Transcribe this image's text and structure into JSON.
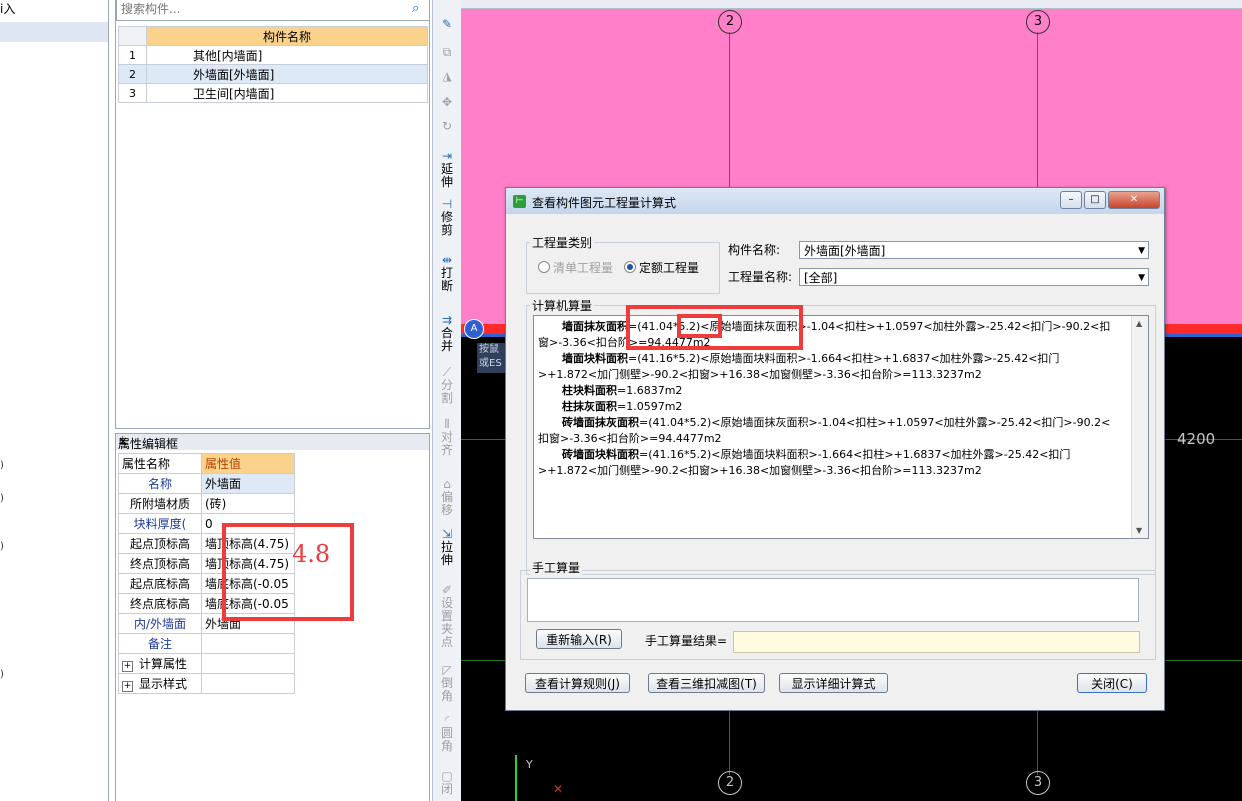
{
  "left_panel": {
    "partial_label": "i入"
  },
  "search": {
    "placeholder": "搜索构件..."
  },
  "component_table": {
    "header": "构件名称",
    "rows": [
      {
        "num": "1",
        "name": "其他[内墙面]"
      },
      {
        "num": "2",
        "name": "外墙面[外墙面]"
      },
      {
        "num": "3",
        "name": "卫生间[内墙面]"
      }
    ],
    "selected_index": 1
  },
  "property_panel": {
    "title": "属性编辑框",
    "pin": "📌",
    "close": "×",
    "col_name": "属性名称",
    "col_value": "属性值",
    "rows": [
      {
        "name": "名称",
        "value": "外墙面"
      },
      {
        "name": "所附墙材质",
        "value": "(砖)"
      },
      {
        "name": "块料厚度(",
        "value": "0"
      },
      {
        "name": "起点顶标高",
        "value": "墙顶标高(4.75)"
      },
      {
        "name": "终点顶标高",
        "value": "墙顶标高(4.75)"
      },
      {
        "name": "起点底标高",
        "value": "墙底标高(-0.05"
      },
      {
        "name": "终点底标高",
        "value": "墙底标高(-0.05"
      },
      {
        "name": "内/外墙面",
        "value": "外墙面"
      },
      {
        "name": "备注",
        "value": ""
      },
      {
        "name": "计算属性",
        "value": "",
        "expand": "+"
      },
      {
        "name": "显示样式",
        "value": "",
        "expand": "+"
      }
    ]
  },
  "vertical_toolbar": {
    "items": [
      {
        "icon": "pencil-icon",
        "label": ""
      },
      {
        "icon": "copy-icon",
        "label": ""
      },
      {
        "icon": "mirror-icon",
        "label": ""
      },
      {
        "icon": "move-icon",
        "label": ""
      },
      {
        "icon": "rotate-icon",
        "label": ""
      },
      {
        "icon": "extend-icon",
        "label": "延伸"
      },
      {
        "icon": "trim-icon",
        "label": "修剪"
      },
      {
        "icon": "break-icon",
        "label": "打断"
      },
      {
        "icon": "merge-icon",
        "label": "合并"
      },
      {
        "icon": "split-icon",
        "label": "分割"
      },
      {
        "icon": "align-icon",
        "label": "对齐"
      },
      {
        "icon": "offset-icon",
        "label": "偏移"
      },
      {
        "icon": "stretch-icon",
        "label": "拉伸"
      },
      {
        "icon": "set-point-icon",
        "label": "设置夹点"
      },
      {
        "icon": "chamfer-icon",
        "label": "倒角"
      },
      {
        "icon": "fillet-icon",
        "label": "圆角"
      },
      {
        "icon": "close-icon",
        "label": "闭"
      }
    ]
  },
  "canvas": {
    "axis_labels_top": [
      "2",
      "3"
    ],
    "axis_labels_bottom": [
      "2",
      "3"
    ],
    "left_axis_label": "A",
    "dimension": "4200",
    "hint_text": "按鼠或ES",
    "y_axis": "Y"
  },
  "dialog": {
    "title": "查看构件图元工程量计算式",
    "qty_type_group": "工程量类别",
    "radio_list": "清单工程量",
    "radio_quota": "定额工程量",
    "component_name_label": "构件名称:",
    "component_name_value": "外墙面[外墙面]",
    "qty_name_label": "工程量名称:",
    "qty_name_value": "[全部]",
    "computer_calc_label": "计算机算量",
    "calc_lines": [
      {
        "key": "墙面抹灰面积",
        "text": "=(41.04*5.2)<原始墙面抹灰面积>-1.04<扣柱>+1.0597<加柱外露>-25.42<扣门>-90.2<扣窗>-3.36<扣台阶>=94.4477m2"
      },
      {
        "key": "墙面块料面积",
        "text": "=(41.16*5.2)<原始墙面块料面积>-1.664<扣柱>+1.6837<加柱外露>-25.42<扣门>+1.872<加门侧壁>-90.2<扣窗>+16.38<加窗侧壁>-3.36<扣台阶>=113.3237m2"
      },
      {
        "key": "柱块料面积",
        "text": "=1.6837m2"
      },
      {
        "key": "柱抹灰面积",
        "text": "=1.0597m2"
      },
      {
        "key": "砖墙面抹灰面积",
        "text": "=(41.04*5.2)<原始墙面抹灰面积>-1.04<扣柱>+1.0597<加柱外露>-25.42<扣门>-90.2<扣窗>-3.36<扣台阶>=94.4477m2"
      },
      {
        "key": "砖墙面块料面积",
        "text": "=(41.16*5.2)<原始墙面块料面积>-1.664<扣柱>+1.6837<加柱外露>-25.42<扣门>+1.872<加门侧壁>-90.2<扣窗>+16.38<加窗侧壁>-3.36<扣台阶>=113.3237m2"
      }
    ],
    "manual_calc_label": "手工算量",
    "reinput_button": "重新输入(R)",
    "manual_result_label": "手工算量结果=",
    "view_rules_button": "查看计算规则(J)",
    "view_3d_button": "查看三维扣减图(T)",
    "show_detail_button": "显示详细计算式",
    "close_button": "关闭(C)"
  },
  "annotation": {
    "number": "4.8"
  },
  "colors": {
    "pink": "#ff7fc8",
    "red_annotation": "#ee3b3b",
    "header_orange": "#fbd28c"
  }
}
